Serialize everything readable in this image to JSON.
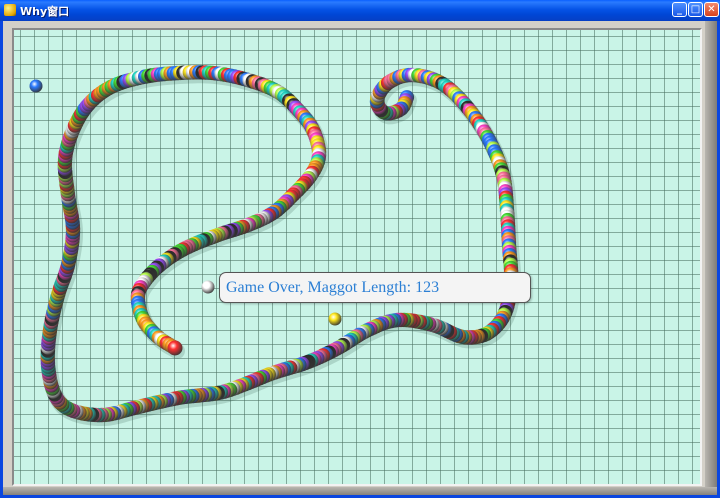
{
  "window": {
    "title": "Why窗口",
    "minimize_label": "_",
    "maximize_label": "□",
    "close_label": "✕",
    "icon": "app-icon"
  },
  "game": {
    "message": "Game Over, Maggot Length: 123",
    "maggot_length": 123,
    "colors": [
      "#ff3030",
      "#ff9a1e",
      "#ffe81c",
      "#44dd33",
      "#1fd6c4",
      "#2a7bff",
      "#9a4bff",
      "#ff3fc8",
      "#ffffff",
      "#2b2b2b",
      "#b6ff4a",
      "#ff6f9a"
    ],
    "background": "#c9f4e7",
    "grid_line_color": "#4f7f6f"
  }
}
